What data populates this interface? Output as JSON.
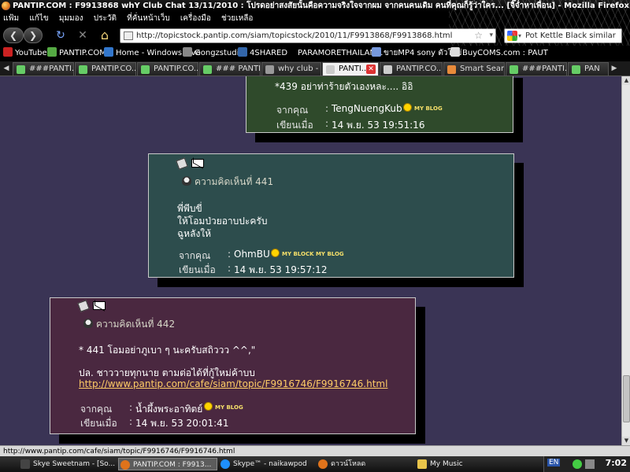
{
  "window": {
    "title": "PANTIP.COM : F9913868 whY Club Chat 13/11/2010 : โปรดอย่าสงสัยนั้นคือความจริงใจจากผม จากคนคนเดิม คนที่คุณก็รู้ว่าใคร... [จิ๊จ่ำหาเพื่อน] - Mozilla Firefox"
  },
  "menu": [
    "แฟ้ม",
    "แก้ไข",
    "มุมมอง",
    "ประวัติ",
    "ที่คั่นหน้าเว็บ",
    "เครื่องมือ",
    "ช่วยเหลือ"
  ],
  "nav": {
    "back_glyph": "❮",
    "forward_glyph": "❯",
    "reload_glyph": "↻",
    "stop_glyph": "✕",
    "home_glyph": "⌂",
    "url": "http://topicstock.pantip.com/siam/topicstock/2010/11/F9913868/F9913868.html",
    "star_glyph": "☆",
    "drop_glyph": "▾",
    "search_text": "Pot Kettle Black similar",
    "search_drop_glyph": "▾"
  },
  "bookmarks": [
    {
      "label": "YouTube",
      "color": "#cc2222"
    },
    {
      "label": "PANTIP.COM",
      "color": "#55aa44"
    },
    {
      "label": "Home - Windows Live",
      "color": "#3377cc"
    },
    {
      "label": "Gongzstudio",
      "color": "#888888"
    },
    {
      "label": "4SHARED",
      "color": "#3366aa"
    },
    {
      "label": "PARAMORETHAILAN...",
      "color": ""
    },
    {
      "label": "ขายMP4 sony ตัวใหม่",
      "color": "#7799dd"
    },
    {
      "label": "BuyCOMS.com : PAUT",
      "color": "#dddddd"
    }
  ],
  "tabs": [
    {
      "label": "###PANTI...",
      "active": false
    },
    {
      "label": "PANTIP.CO...",
      "active": false
    },
    {
      "label": "PANTIP.CO...",
      "active": false
    },
    {
      "label": "### PANTI...",
      "active": false
    },
    {
      "label": "why club - ...",
      "active": false
    },
    {
      "label": "PANTI...",
      "active": true
    },
    {
      "label": "PANTIP.CO...",
      "active": false
    },
    {
      "label": "Smart Searc...",
      "active": false
    },
    {
      "label": "###PANTI...",
      "active": false
    },
    {
      "label": "PAN",
      "active": false
    }
  ],
  "tab_glyphs": {
    "left": "◀",
    "right": "▶",
    "close": "✕"
  },
  "posts": [
    {
      "bg": "#2f4a2b",
      "header_text": "",
      "body": [
        "*439  อย่าท่าร้ายตัวเองหละ.... อิอิ"
      ],
      "link": "",
      "from_label": "จากคุณ",
      "from_name": "TengNuengKub",
      "time_label": "เขียนเมื่อ",
      "time": "14 พ.ย. 53 19:51:16",
      "badges": "MY BLOG"
    },
    {
      "bg": "#2d4d4d",
      "header_text": "ความคิดเห็นที่ 441",
      "body": [
        "พี่พีบขี่",
        "ให้โอมป่วยอาบปะครับ",
        "ฉูหลังให้"
      ],
      "link": "",
      "from_label": "จากคุณ",
      "from_name": "OhmBU",
      "time_label": "เขียนเมื่อ",
      "time": "14 พ.ย. 53 19:57:12",
      "badges": "MY BLOCK MY BLOG"
    },
    {
      "bg": "#4a2840",
      "header_text": "ความคิดเห็นที่ 442",
      "body": [
        "* 441 โอมอย่าภูเบา ๆ นะครับสถิววว ^^,\"",
        "",
        "ปล. ชาววายทุกนาย ตามต่อได้ที่กู้ใหม่ค้าบบ"
      ],
      "link": "http://www.pantip.com/cafe/siam/topic/F9916746/F9916746.html",
      "from_label": "จากคุณ",
      "from_name": "น้ำผึ้งพระอาทิตย์",
      "time_label": "เขียนเมื่อ",
      "time": "14 พ.ย. 53 20:01:41",
      "badges": "MY BLOG"
    }
  ],
  "status": "http://www.pantip.com/cafe/siam/topic/F9916746/F9916746.html",
  "taskbar": [
    {
      "label": "Skye Sweetnam - [So...",
      "color": "#444444",
      "active": false
    },
    {
      "label": "PANTIP.COM : F9913...",
      "color": "#e0731b",
      "active": true
    },
    {
      "label": "Skype™ - naikawpod",
      "color": "#1e90ff",
      "active": false
    },
    {
      "label": "ดาวน์โหลด",
      "color": "#e0731b",
      "active": false
    },
    {
      "label": "My Music",
      "color": "#e8c44a",
      "active": false
    }
  ],
  "tray": {
    "lang": "EN",
    "clock": "7:02"
  }
}
